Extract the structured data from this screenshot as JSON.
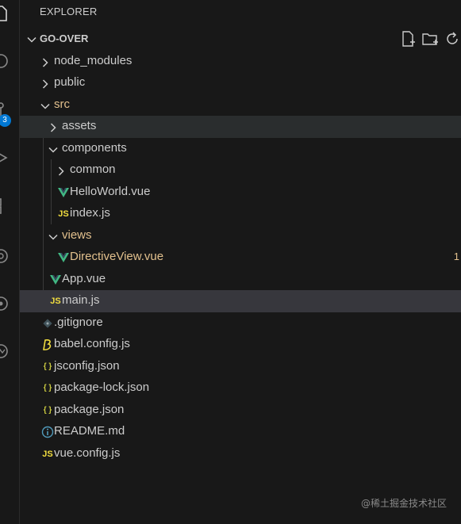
{
  "explorer": {
    "title": "EXPLORER",
    "section_title": "GO-OVER"
  },
  "activity_bar": {
    "source_control_badge": "3"
  },
  "icons": {
    "new_file": "new-file-icon",
    "new_folder": "new-folder-icon",
    "refresh": "refresh-icon"
  },
  "tree": [
    {
      "label": "node_modules",
      "type": "folder",
      "expanded": false,
      "depth": 0
    },
    {
      "label": "public",
      "type": "folder",
      "expanded": false,
      "depth": 0
    },
    {
      "label": "src",
      "type": "folder",
      "expanded": true,
      "depth": 0,
      "modified": true
    },
    {
      "label": "assets",
      "type": "folder",
      "expanded": false,
      "depth": 1,
      "state": "highlight"
    },
    {
      "label": "components",
      "type": "folder",
      "expanded": true,
      "depth": 1
    },
    {
      "label": "common",
      "type": "folder",
      "expanded": false,
      "depth": 2
    },
    {
      "label": "HelloWorld.vue",
      "type": "vue",
      "depth": 2
    },
    {
      "label": "index.js",
      "type": "js",
      "depth": 2
    },
    {
      "label": "views",
      "type": "folder",
      "expanded": true,
      "depth": 1,
      "modified": true
    },
    {
      "label": "DirectiveView.vue",
      "type": "vue",
      "depth": 2,
      "modified": true,
      "decoration": "1"
    },
    {
      "label": "App.vue",
      "type": "vue",
      "depth": 1
    },
    {
      "label": "main.js",
      "type": "js",
      "depth": 1,
      "state": "selected"
    },
    {
      "label": ".gitignore",
      "type": "git",
      "depth": 0
    },
    {
      "label": "babel.config.js",
      "type": "babel",
      "depth": 0
    },
    {
      "label": "jsconfig.json",
      "type": "json",
      "depth": 0
    },
    {
      "label": "package-lock.json",
      "type": "json",
      "depth": 0
    },
    {
      "label": "package.json",
      "type": "json",
      "depth": 0
    },
    {
      "label": "README.md",
      "type": "info",
      "depth": 0
    },
    {
      "label": "vue.config.js",
      "type": "js",
      "depth": 0
    }
  ],
  "watermark": "@稀土掘金技术社区",
  "colors": {
    "sidebar_bg": "#181818",
    "text": "#cccccc",
    "modified": "#e2c08d",
    "vue": "#41b883",
    "js": "#f1dd3f",
    "json": "#cbcb41",
    "info": "#519aba",
    "accent": "#0078d4"
  }
}
